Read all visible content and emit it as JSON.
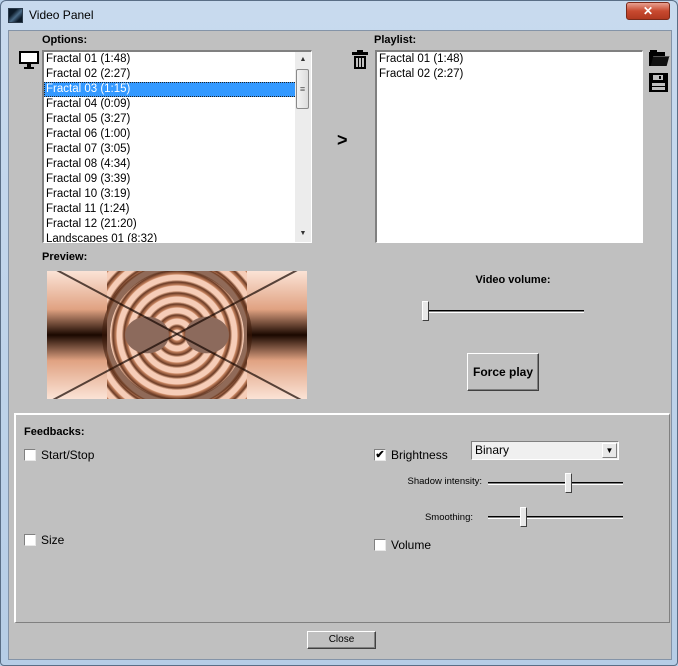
{
  "window": {
    "title": "Video Panel",
    "close_glyph": "✕"
  },
  "options": {
    "label": "Options:",
    "icon": "monitor-icon",
    "items": [
      {
        "label": "Fractal 01 (1:48)",
        "selected": false
      },
      {
        "label": "Fractal 02 (2:27)",
        "selected": false
      },
      {
        "label": "Fractal 03 (1:15)",
        "selected": true
      },
      {
        "label": "Fractal 04 (0:09)",
        "selected": false
      },
      {
        "label": "Fractal 05 (3:27)",
        "selected": false
      },
      {
        "label": "Fractal 06 (1:00)",
        "selected": false
      },
      {
        "label": "Fractal 07 (3:05)",
        "selected": false
      },
      {
        "label": "Fractal 08 (4:34)",
        "selected": false
      },
      {
        "label": "Fractal 09 (3:39)",
        "selected": false
      },
      {
        "label": "Fractal 10 (3:19)",
        "selected": false
      },
      {
        "label": "Fractal 11 (1:24)",
        "selected": false
      },
      {
        "label": "Fractal 12 (21:20)",
        "selected": false
      },
      {
        "label": "Landscapes 01 (8:32)",
        "selected": false
      }
    ],
    "scroll_up_glyph": "▲",
    "scroll_down_glyph": "▼",
    "scroll_thumb_glyph": "≡"
  },
  "add_to_playlist": {
    "glyph": ">"
  },
  "playlist": {
    "label": "Playlist:",
    "items": [
      {
        "label": "Fractal 01 (1:48)"
      },
      {
        "label": "Fractal 02 (2:27)"
      }
    ],
    "delete_icon": "trash-icon",
    "open_icon": "folder-open-icon",
    "save_icon": "floppy-save-icon"
  },
  "preview": {
    "label": "Preview:"
  },
  "video_volume": {
    "label": "Video volume:",
    "value_fraction": 0.0
  },
  "force_play": {
    "label": "Force play"
  },
  "feedbacks": {
    "label": "Feedbacks:",
    "start_stop": {
      "label": "Start/Stop",
      "checked": false
    },
    "size": {
      "label": "Size",
      "checked": false
    },
    "brightness": {
      "label": "Brightness",
      "checked": true
    },
    "volume": {
      "label": "Volume",
      "checked": false
    },
    "mode_select": {
      "value": "Binary",
      "dropdown_glyph": "▼"
    },
    "shadow_intensity": {
      "label": "Shadow intensity:",
      "value_fraction": 0.6
    },
    "smoothing": {
      "label": "Smoothing:",
      "value_fraction": 0.25
    },
    "check_glyph": "✔"
  },
  "footer": {
    "close_label": "Close"
  }
}
